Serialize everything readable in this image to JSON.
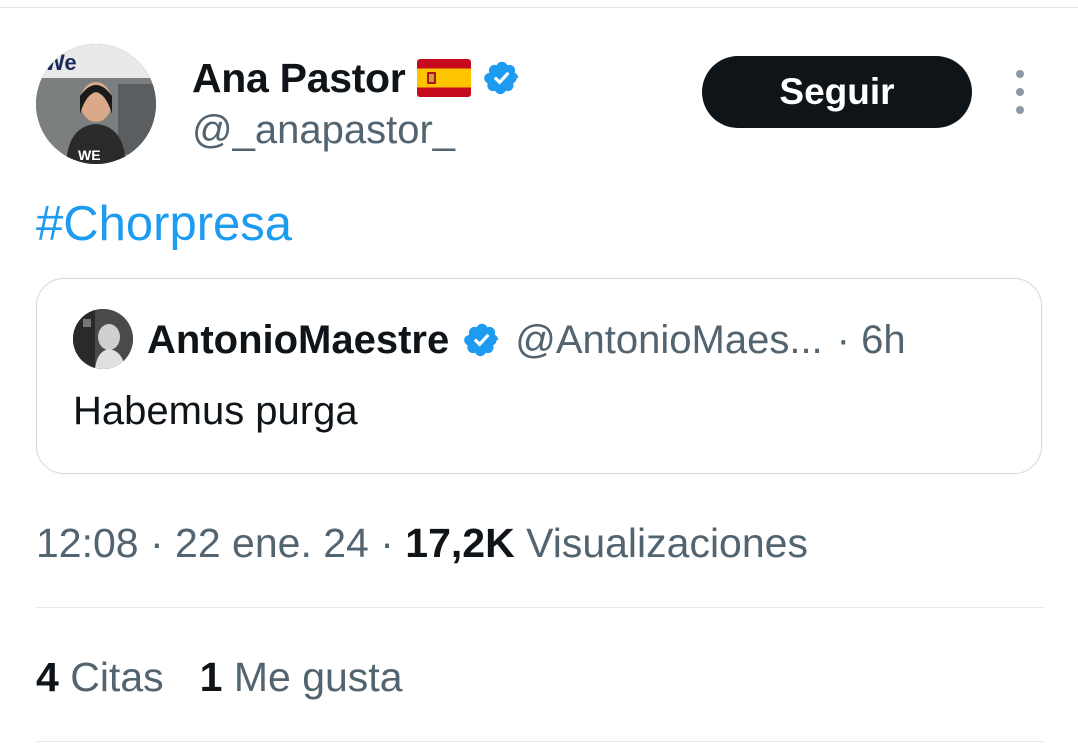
{
  "author": {
    "display_name": "Ana Pastor",
    "handle": "@_anapastor_",
    "verified": true,
    "flag_icon": "spain-flag-icon",
    "avatar_text": "We"
  },
  "actions": {
    "follow_label": "Seguir",
    "more_icon": "more-vertical-icon"
  },
  "tweet": {
    "text": "#Chorpresa"
  },
  "quoted": {
    "display_name": "AntonioMaestre",
    "handle": "@AntonioMaes...",
    "time": "· 6h",
    "verified": true,
    "text": "Habemus purga"
  },
  "meta": {
    "time": "12:08",
    "sep1": " · ",
    "date": "22 ene. 24",
    "sep2": " · ",
    "views_count": "17,2K",
    "views_label": "Visualizaciones"
  },
  "stats": {
    "quotes_count": "4",
    "quotes_label": "Citas",
    "likes_count": "1",
    "likes_label": "Me gusta"
  },
  "colors": {
    "accent": "#1d9bf0",
    "text": "#0f1419",
    "muted": "#536471",
    "button": "#0f1419"
  }
}
